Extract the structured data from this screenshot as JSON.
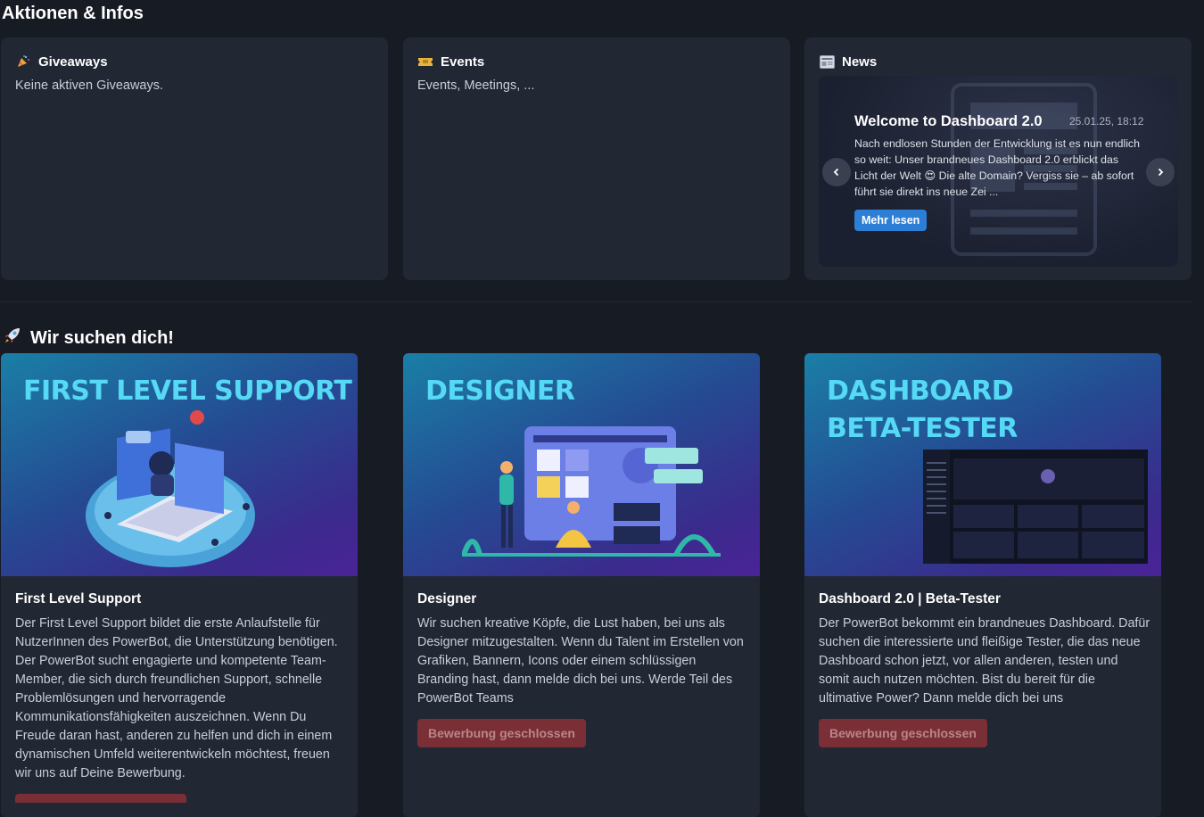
{
  "sections": {
    "actions_title": "Aktionen & Infos",
    "jobs_title": "Wir suchen dich!"
  },
  "cards": {
    "giveaways": {
      "icon": "party-popper-icon",
      "title": "Giveaways",
      "text": "Keine aktiven Giveaways."
    },
    "events": {
      "icon": "ticket-icon",
      "title": "Events",
      "text": "Events, Meetings, ..."
    },
    "news": {
      "icon": "newspaper-icon",
      "title": "News",
      "item": {
        "title": "Welcome to Dashboard 2.0",
        "date": "25.01.25, 18:12",
        "body_1": "Nach endlosen Stunden der Entwicklung ist es nun endlich so weit: Unser brandneues Dashboard 2.0 erblickt das Licht der Welt ",
        "emoji": "😍",
        "body_2": " Die alte Domain? Vergiss sie – ab sofort führt sie direkt ins neue Zei ...",
        "button": "Mehr lesen"
      }
    }
  },
  "jobs": [
    {
      "banner_lines": [
        "FIRST LEVEL SUPPORT"
      ],
      "title": "First Level Support",
      "text": "Der First Level Support bildet die erste Anlaufstelle für NutzerInnen des PowerBot, die Unterstützung benötigen. Der PowerBot sucht engagierte und kompetente Team-Member, die sich durch freundlichen Support, schnelle Problemlösungen und hervorragende Kommunikationsfähigkeiten auszeichnen. Wenn Du Freude daran hast, anderen zu helfen und dich in einem dynamischen Umfeld weiterentwickeln möchtest, freuen wir uns auf Deine Bewerbung."
    },
    {
      "banner_lines": [
        "DESIGNER"
      ],
      "title": "Designer",
      "text": "Wir suchen kreative Köpfe, die Lust haben, bei uns als Designer mitzugestalten. Wenn du Talent im Erstellen von Grafiken, Bannern, Icons oder einem schlüssigen Branding hast, dann melde dich bei uns. Werde Teil des PowerBot Teams",
      "button": "Bewerbung geschlossen"
    },
    {
      "banner_lines": [
        "DASHBOARD",
        "BETA-TESTER"
      ],
      "title": "Dashboard 2.0 | Beta-Tester",
      "text": "Der PowerBot bekommt ein brandneues Dashboard. Dafür suchen die interessierte und fleißige Tester, die das neue Dashboard schon jetzt, vor allen anderen, testen und somit auch nutzen möchten. Bist du bereit für die ultimative Power? Dann melde dich bei uns",
      "button": "Bewerbung geschlossen"
    }
  ],
  "colors": {
    "background": "#171b23",
    "card": "#212733",
    "accent_blue": "#2d7fd6",
    "closed_button": "#7a2f36",
    "banner_text": "#56d9f4"
  }
}
